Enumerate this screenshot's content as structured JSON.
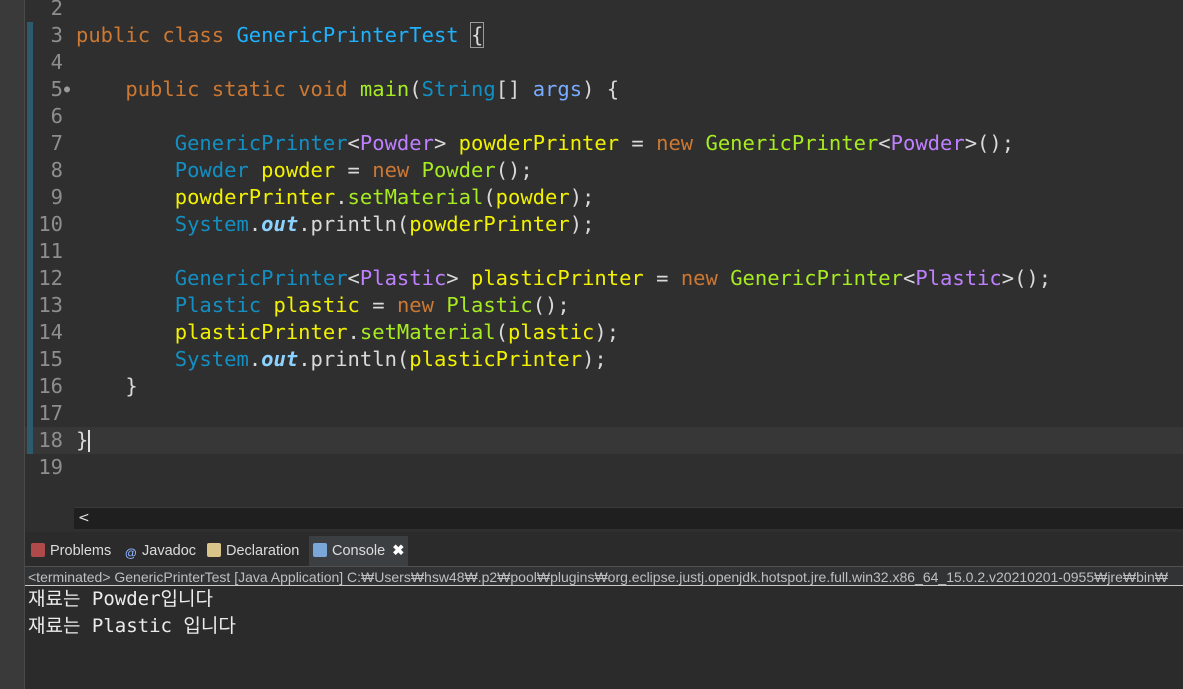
{
  "editor": {
    "lines": [
      {
        "num": "2",
        "html": ""
      },
      {
        "num": "3",
        "html": "<span class='kw'>public</span> <span class='kw'>class</span> <span class='cls'>GenericPrinterTest</span> <span class='bracket-box'>{</span>"
      },
      {
        "num": "4",
        "html": ""
      },
      {
        "num": "5",
        "html": "    <span class='kw'>public</span> <span class='kw'>static</span> <span class='kw'>void</span> <span class='meth'>main</span>(<span class='type'>String</span>[] <span class='arg'>args</span>) {"
      },
      {
        "num": "6",
        "html": ""
      },
      {
        "num": "7",
        "html": "        <span class='type'>GenericPrinter</span>&lt;<span class='gen'>Powder</span>&gt; <span class='var'>powderPrinter</span> = <span class='kw'>new</span> <span class='meth'>GenericPrinter</span>&lt;<span class='gen'>Powder</span>&gt;();"
      },
      {
        "num": "8",
        "html": "        <span class='type'>Powder</span> <span class='var'>powder</span> = <span class='kw'>new</span> <span class='meth'>Powder</span>();"
      },
      {
        "num": "9",
        "html": "        <span class='var'>powderPrinter</span>.<span class='meth'>setMaterial</span>(<span class='var'>powder</span>);"
      },
      {
        "num": "10",
        "html": "        <span class='type'>System</span>.<span class='field'>out</span>.println(<span class='var'>powderPrinter</span>);"
      },
      {
        "num": "11",
        "html": ""
      },
      {
        "num": "12",
        "html": "        <span class='type'>GenericPrinter</span>&lt;<span class='gen'>Plastic</span>&gt; <span class='var'>plasticPrinter</span> = <span class='kw'>new</span> <span class='meth'>GenericPrinter</span>&lt;<span class='gen'>Plastic</span>&gt;();"
      },
      {
        "num": "13",
        "html": "        <span class='type'>Plastic</span> <span class='var'>plastic</span> = <span class='kw'>new</span> <span class='meth'>Plastic</span>();"
      },
      {
        "num": "14",
        "html": "        <span class='var'>plasticPrinter</span>.<span class='meth'>setMaterial</span>(<span class='var'>plastic</span>);"
      },
      {
        "num": "15",
        "html": "        <span class='type'>System</span>.<span class='field'>out</span>.println(<span class='var'>plasticPrinter</span>);"
      },
      {
        "num": "16",
        "html": "    }"
      },
      {
        "num": "17",
        "html": ""
      },
      {
        "num": "18",
        "html": "}<span class='caret'></span>"
      },
      {
        "num": "19",
        "html": ""
      }
    ]
  },
  "scroll": {
    "left_arrow": "<"
  },
  "tabs": [
    {
      "label": "Problems",
      "icon": "problems-icon"
    },
    {
      "label": "Javadoc",
      "icon": "javadoc-icon"
    },
    {
      "label": "Declaration",
      "icon": "declaration-icon"
    },
    {
      "label": "Console",
      "icon": "console-icon",
      "close": "✖"
    }
  ],
  "console": {
    "status": "<terminated> GenericPrinterTest [Java Application] C:₩Users₩hsw48₩.p2₩pool₩plugins₩org.eclipse.justj.openjdk.hotspot.jre.full.win32.x86_64_15.0.2.v20210201-0955₩jre₩bin₩",
    "output": [
      "재료는 Powder입니다",
      "재료는 Plastic 입니다"
    ]
  },
  "colors": {
    "keyword": "#cc7832",
    "type": "#1290c3",
    "variable": "#f2f200",
    "method": "#a7ec21",
    "generic": "#bf80ff"
  }
}
